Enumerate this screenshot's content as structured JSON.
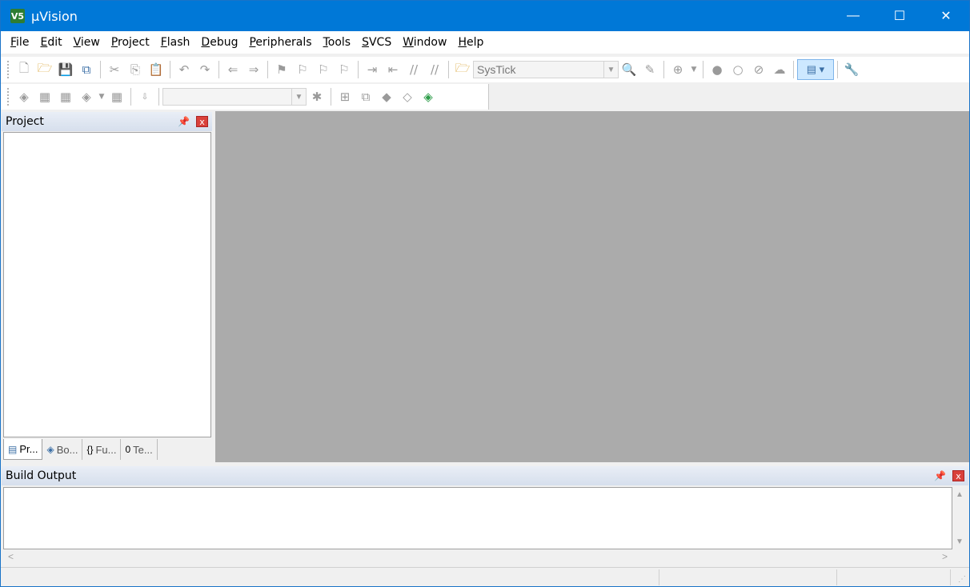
{
  "window": {
    "title": "µVision",
    "app_icon": "V5",
    "minimize": "—",
    "maximize": "☐",
    "close": "✕"
  },
  "menu": [
    "File",
    "Edit",
    "View",
    "Project",
    "Flash",
    "Debug",
    "Peripherals",
    "Tools",
    "SVCS",
    "Window",
    "Help"
  ],
  "toolbar1": {
    "target_combo": "SysTick"
  },
  "project_panel": {
    "title": "Project",
    "pin": "📌",
    "close": "x",
    "tabs": [
      {
        "label": "Pr...",
        "icon": "▤"
      },
      {
        "label": "Bo...",
        "icon": "◈"
      },
      {
        "label": "Fu...",
        "icon": "{}"
      },
      {
        "label": "Te...",
        "icon": "0"
      }
    ]
  },
  "build_output": {
    "title": "Build Output",
    "pin": "📌",
    "close": "x"
  }
}
